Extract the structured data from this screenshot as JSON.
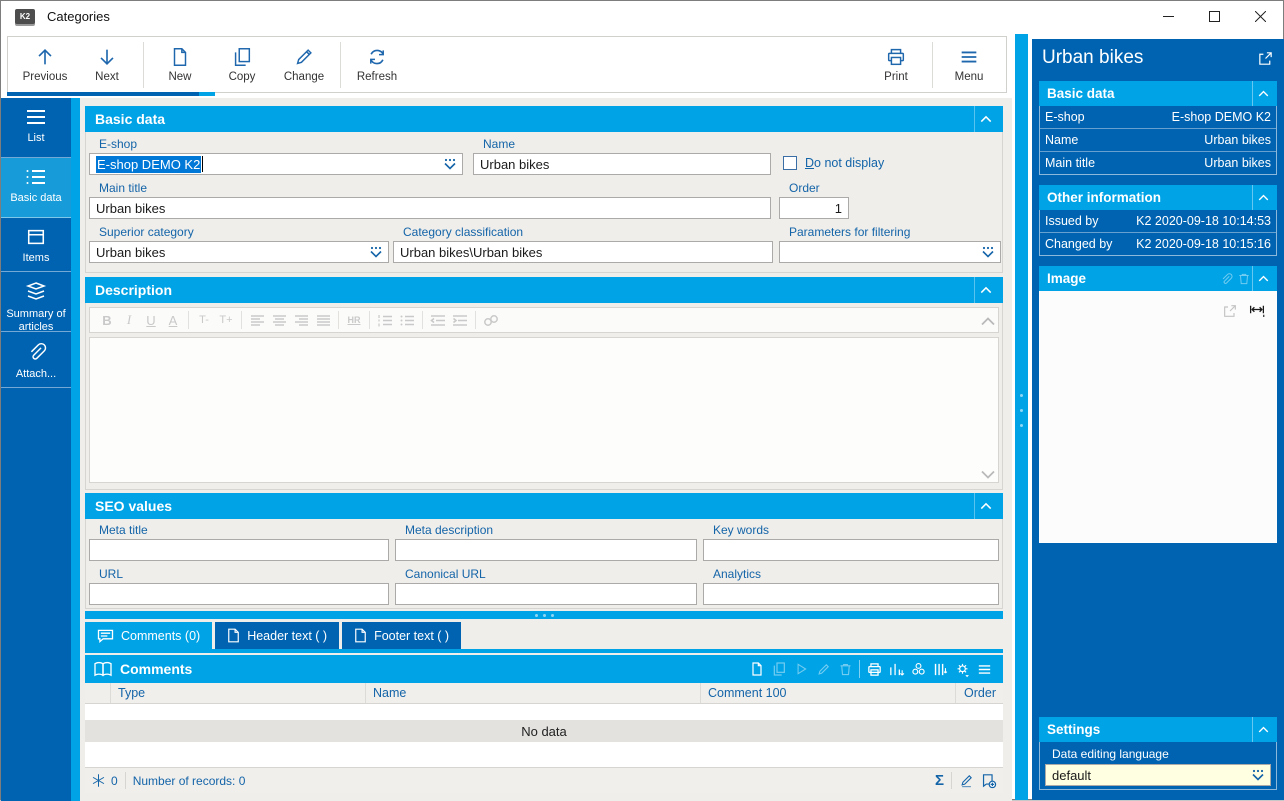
{
  "window": {
    "title": "Categories",
    "logo_text": "K2"
  },
  "toolbar": {
    "buttons": [
      {
        "label": "Previous"
      },
      {
        "label": "Next"
      },
      {
        "label": "New"
      },
      {
        "label": "Copy"
      },
      {
        "label": "Change"
      },
      {
        "label": "Refresh"
      }
    ],
    "right_buttons": [
      {
        "label": "Print"
      },
      {
        "label": "Menu"
      }
    ]
  },
  "sidebar": {
    "items": [
      {
        "label": "List"
      },
      {
        "label": "Basic data"
      },
      {
        "label": "Items"
      },
      {
        "label": "Summary of articles"
      },
      {
        "label": "Attach..."
      }
    ]
  },
  "basic_data": {
    "title": "Basic data",
    "eshop_label": "E-shop",
    "eshop_value": "E-shop DEMO K2",
    "name_label": "Name",
    "name_value": "Urban bikes",
    "do_not_display_label": "Do not display",
    "main_title_label": "Main title",
    "main_title_value": "Urban bikes",
    "order_label": "Order",
    "order_value": "1",
    "superior_label": "Superior category",
    "superior_value": "Urban bikes",
    "classification_label": "Category classification",
    "classification_value": "Urban bikes\\Urban bikes",
    "parameters_label": "Parameters for filtering",
    "parameters_value": ""
  },
  "description": {
    "title": "Description",
    "content": "",
    "glyphs": {
      "bold": "B",
      "italic": "I",
      "underline": "U",
      "color": "A",
      "smaller": "T-",
      "larger": "T+",
      "hr": "HR"
    }
  },
  "seo": {
    "title": "SEO values",
    "meta_title_label": "Meta title",
    "meta_title_value": "",
    "meta_description_label": "Meta description",
    "meta_description_value": "",
    "key_words_label": "Key words",
    "key_words_value": "",
    "url_label": "URL",
    "url_value": "",
    "canonical_url_label": "Canonical URL",
    "canonical_url_value": "",
    "analytics_label": "Analytics",
    "analytics_value": ""
  },
  "tabs": [
    {
      "label": "Comments (0)"
    },
    {
      "label": "Header text ( )"
    },
    {
      "label": "Footer text ( )"
    }
  ],
  "comments": {
    "title": "Comments",
    "columns": [
      "Type",
      "Name",
      "Comment 100",
      "Order"
    ],
    "empty_text": "No data",
    "frozen_count": "0",
    "records_label": "Number of records: 0",
    "sum_glyph": "Σ"
  },
  "right_panel": {
    "title": "Urban bikes",
    "basic": {
      "title": "Basic data",
      "rows": [
        {
          "label": "E-shop",
          "value": "E-shop DEMO K2"
        },
        {
          "label": "Name",
          "value": "Urban bikes"
        },
        {
          "label": "Main title",
          "value": "Urban bikes"
        }
      ]
    },
    "other": {
      "title": "Other information",
      "rows": [
        {
          "label": "Issued by",
          "value": "K2 2020-09-18 10:14:53"
        },
        {
          "label": "Changed by",
          "value": "K2 2020-09-18 10:15:16"
        }
      ]
    },
    "image": {
      "title": "Image"
    },
    "settings": {
      "title": "Settings",
      "language_label": "Data editing language",
      "language_value": "default"
    }
  },
  "colors": {
    "dark_blue": "#0063B1",
    "cyan": "#00A3E6",
    "selection": "#0078D7",
    "label_blue": "#1464A8",
    "field_yellow": "#FFFFE1"
  }
}
